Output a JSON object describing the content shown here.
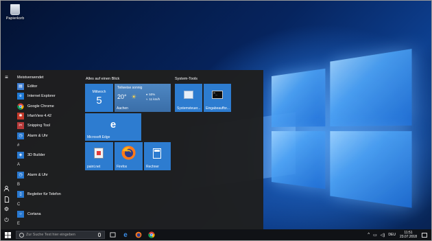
{
  "desktop": {
    "recycle_bin_label": "Papierkorb"
  },
  "start_menu": {
    "most_used_header": "Meistverwendet",
    "most_used": [
      {
        "label": "Editor",
        "icon": "notepad-icon",
        "color": "#3f7fd4"
      },
      {
        "label": "Internet Explorer",
        "icon": "internet-explorer-icon",
        "color": "#1f7ad6"
      },
      {
        "label": "Google Chrome",
        "icon": "chrome-icon",
        "color": "#e8e8e8"
      },
      {
        "label": "IrfanView 4.42",
        "icon": "irfanview-icon",
        "color": "#c53a2a"
      },
      {
        "label": "Snipping Tool",
        "icon": "snipping-tool-icon",
        "color": "#b83a3a"
      },
      {
        "label": "Alarm & Uhr",
        "icon": "alarm-clock-icon",
        "color": "#2878d0"
      }
    ],
    "letter_hash": "#",
    "hash_apps": [
      {
        "label": "3D Builder",
        "icon": "3d-builder-icon",
        "color": "#2878d0"
      }
    ],
    "letter_a": "A",
    "a_apps": [
      {
        "label": "Alarm & Uhr",
        "icon": "alarm-clock-icon",
        "color": "#2878d0"
      }
    ],
    "letter_b": "B",
    "b_apps": [
      {
        "label": "Begleiter für Telefon",
        "icon": "phone-companion-icon",
        "color": "#2878d0"
      }
    ],
    "letter_c": "C",
    "c_apps": [
      {
        "label": "Cortana",
        "icon": "cortana-icon",
        "color": "#2878d0"
      }
    ],
    "letter_e": "E",
    "group_glance": "Alles auf einen Blick",
    "group_system": "System-Tools",
    "calendar_tile": {
      "day_name": "Mittwoch",
      "day_number": "5"
    },
    "weather_tile": {
      "condition": "Teilweise sonnig",
      "temperature": "20°",
      "humidity": "50%",
      "wind": "11 km/h",
      "city": "Aachen",
      "icon": "partly-sunny-icon"
    },
    "edge_tile": {
      "label": "Microsoft Edge",
      "icon": "edge-icon"
    },
    "paint_tile": {
      "label": "paint.net",
      "icon": "paint-net-icon"
    },
    "firefox_tile": {
      "label": "Firefox",
      "icon": "firefox-icon"
    },
    "calc_tile": {
      "label": "Rechner",
      "icon": "calculator-icon"
    },
    "sysctl_tile": {
      "label": "Systemsteuer...",
      "icon": "control-panel-icon"
    },
    "cmd_tile": {
      "label": "Eingabeauffor...",
      "icon": "command-prompt-icon"
    }
  },
  "taskbar": {
    "search_placeholder": "Zur Suche Text hier eingeben",
    "language": "DEU",
    "time": "11:51",
    "date": "23.07.2018"
  },
  "colors": {
    "tile_blue": "#2d7cd0",
    "tile_dark": "#3a3d44",
    "menu_bg": "#1f1f1f",
    "taskbar_bg": "#101216"
  }
}
